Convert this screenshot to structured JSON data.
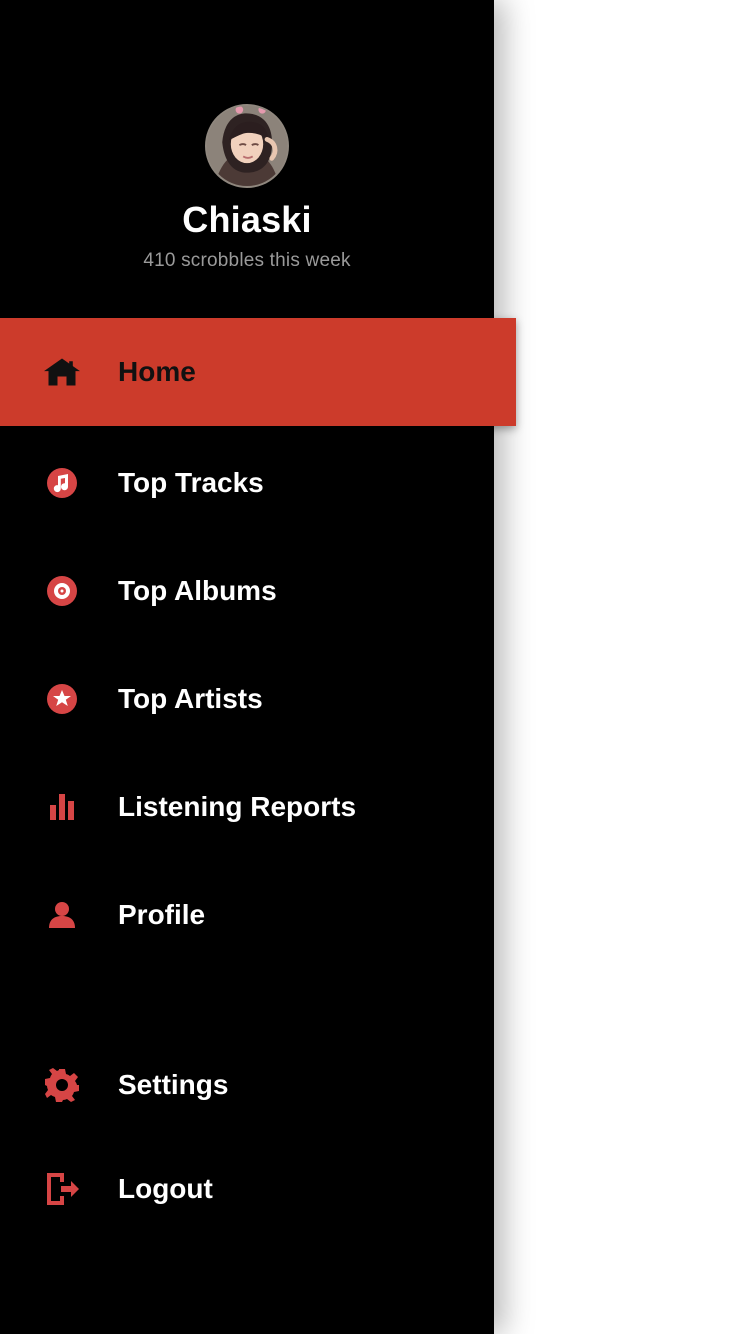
{
  "user": {
    "name": "Chiaski",
    "scrobbles": "410 scrobbles this week",
    "avatar": "user-avatar-photo"
  },
  "colors": {
    "drawer_background": "#000000",
    "accent": "#cc3b2b",
    "icon": "#d64545",
    "active_text": "#111111",
    "text": "#ffffff",
    "muted_text": "#9a9a9a"
  },
  "nav": {
    "items": [
      {
        "label": "Home",
        "icon": "home-icon",
        "active": true
      },
      {
        "label": "Top Tracks",
        "icon": "music-note-icon",
        "active": false
      },
      {
        "label": "Top Albums",
        "icon": "album-disc-icon",
        "active": false
      },
      {
        "label": "Top Artists",
        "icon": "star-icon",
        "active": false
      },
      {
        "label": "Listening Reports",
        "icon": "bar-chart-icon",
        "active": false
      },
      {
        "label": "Profile",
        "icon": "user-icon",
        "active": false
      }
    ],
    "footer_items": [
      {
        "label": "Settings",
        "icon": "gear-icon"
      },
      {
        "label": "Logout",
        "icon": "logout-icon"
      }
    ]
  }
}
